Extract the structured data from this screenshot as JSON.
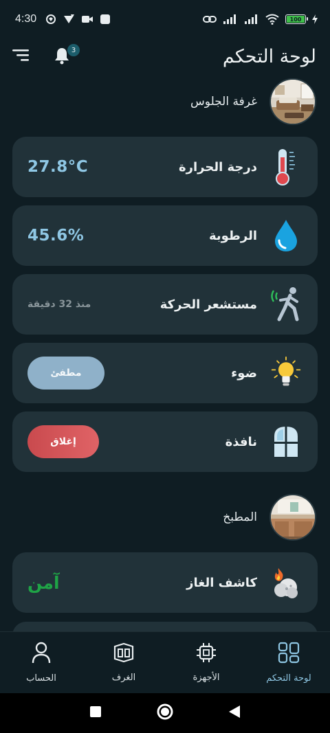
{
  "status_bar": {
    "time": "4:30",
    "battery": "100"
  },
  "header": {
    "title": "لوحة التحكم",
    "notification_count": "3"
  },
  "rooms": [
    {
      "name": "غرفة الجلوس",
      "devices": {
        "temperature": {
          "label": "درجة الحرارة",
          "value": "27.8°C"
        },
        "humidity": {
          "label": "الرطوبة",
          "value": "45.6%"
        },
        "motion": {
          "label": "مستشعر الحركة",
          "value": "منذ 32 دقيقة"
        },
        "light": {
          "label": "ضوء",
          "button": "مطفئ"
        },
        "window": {
          "label": "نافذة",
          "button": "إغلاق"
        }
      }
    },
    {
      "name": "المطبخ",
      "devices": {
        "gas": {
          "label": "كاشف الغاز",
          "value": "آمن"
        }
      }
    }
  ],
  "bottom_nav": [
    {
      "label": "لوحة التحكم",
      "icon": "dashboard-icon",
      "active": true
    },
    {
      "label": "الأجهزة",
      "icon": "chip-icon"
    },
    {
      "label": "الغرف",
      "icon": "rooms-icon"
    },
    {
      "label": "الحساب",
      "icon": "user-icon"
    }
  ],
  "colors": {
    "background": "#0f1d23",
    "card": "#213239",
    "accent_blue": "#8fc7e4",
    "safe_green": "#1fa346",
    "close_red": "#d9585c",
    "off_button": "#8fb1c9"
  }
}
